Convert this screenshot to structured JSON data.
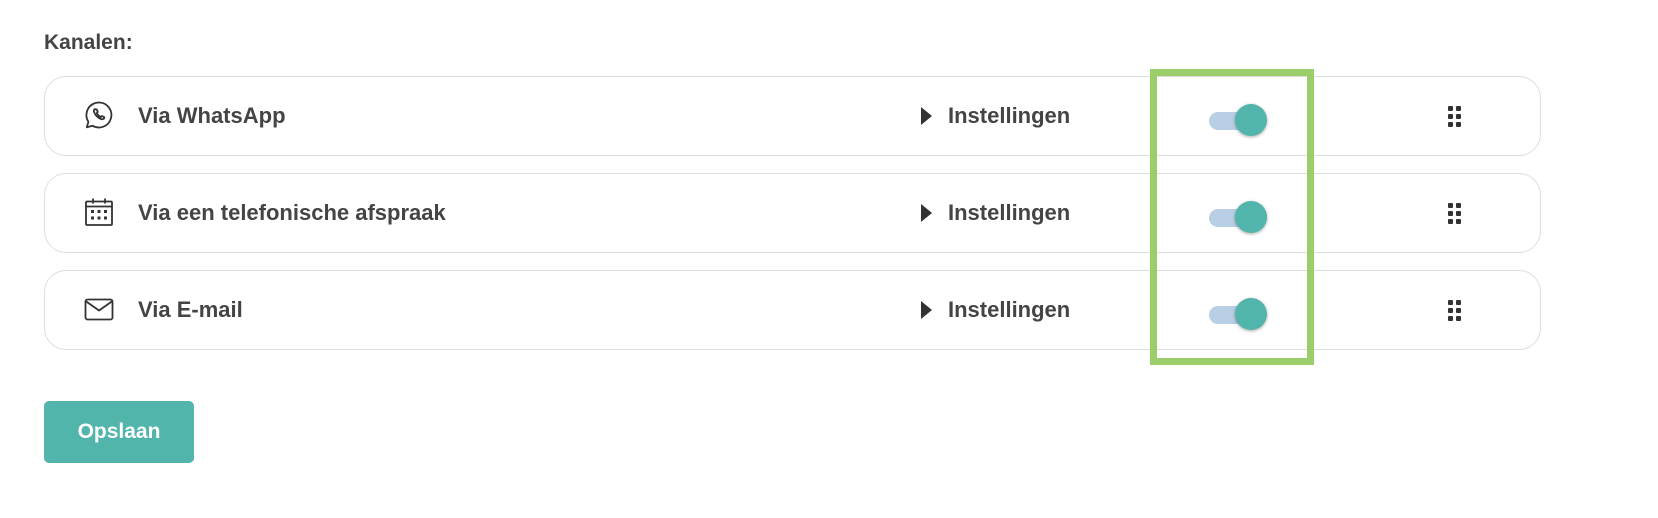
{
  "section": {
    "label": "Kanalen:"
  },
  "channels": [
    {
      "name": "Via WhatsApp",
      "icon": "whatsapp-icon",
      "settings_label": "Instellingen",
      "enabled": true
    },
    {
      "name": "Via een telefonische afspraak",
      "icon": "calendar-icon",
      "settings_label": "Instellingen",
      "enabled": true
    },
    {
      "name": "Via E-mail",
      "icon": "mail-icon",
      "settings_label": "Instellingen",
      "enabled": true
    }
  ],
  "actions": {
    "save_label": "Opslaan"
  },
  "colors": {
    "accent": "#52b5ab",
    "toggle_track": "#b9cfe6",
    "highlight": "#9bcd6a",
    "text": "#444444",
    "border": "#dedede"
  }
}
